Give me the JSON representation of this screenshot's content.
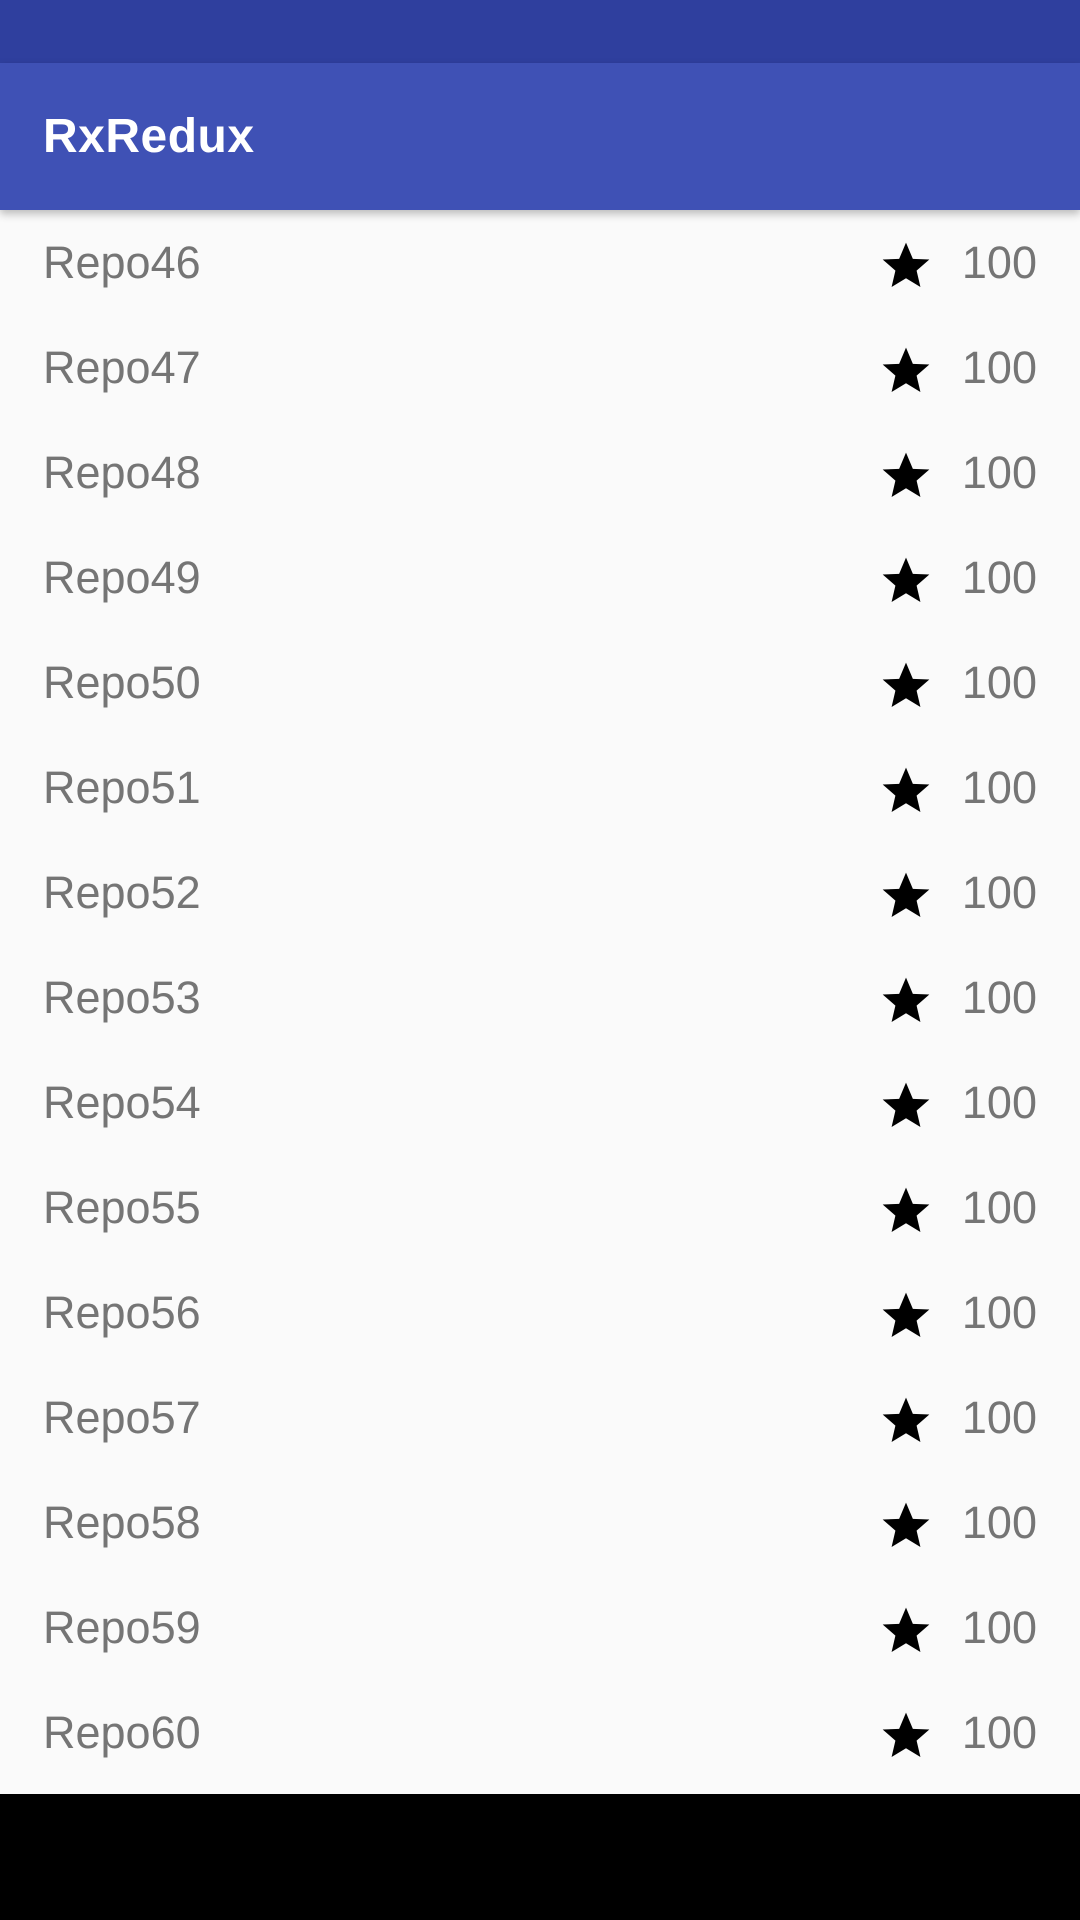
{
  "colors": {
    "status_bar": "#2f3f9e",
    "app_bar": "#3f51b5",
    "list_background": "#fafafa",
    "text_secondary": "#757575",
    "star": "#000000",
    "nav_bar": "#000000"
  },
  "app_bar": {
    "title": "RxRedux"
  },
  "repos": [
    {
      "name": "Repo46",
      "stars": "100",
      "icon": "star-icon"
    },
    {
      "name": "Repo47",
      "stars": "100",
      "icon": "star-icon"
    },
    {
      "name": "Repo48",
      "stars": "100",
      "icon": "star-icon"
    },
    {
      "name": "Repo49",
      "stars": "100",
      "icon": "star-icon"
    },
    {
      "name": "Repo50",
      "stars": "100",
      "icon": "star-icon"
    },
    {
      "name": "Repo51",
      "stars": "100",
      "icon": "star-icon"
    },
    {
      "name": "Repo52",
      "stars": "100",
      "icon": "star-icon"
    },
    {
      "name": "Repo53",
      "stars": "100",
      "icon": "star-icon"
    },
    {
      "name": "Repo54",
      "stars": "100",
      "icon": "star-icon"
    },
    {
      "name": "Repo55",
      "stars": "100",
      "icon": "star-icon"
    },
    {
      "name": "Repo56",
      "stars": "100",
      "icon": "star-icon"
    },
    {
      "name": "Repo57",
      "stars": "100",
      "icon": "star-icon"
    },
    {
      "name": "Repo58",
      "stars": "100",
      "icon": "star-icon"
    },
    {
      "name": "Repo59",
      "stars": "100",
      "icon": "star-icon"
    },
    {
      "name": "Repo60",
      "stars": "100",
      "icon": "star-icon"
    }
  ]
}
